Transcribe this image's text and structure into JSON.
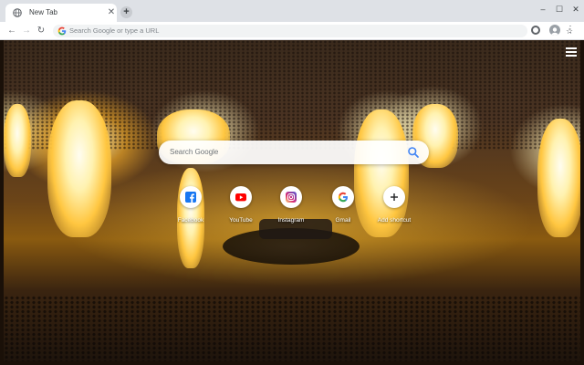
{
  "tab": {
    "title": "New Tab",
    "close_glyph": "✕",
    "favicon": "globe-icon"
  },
  "new_tab_glyph": "+",
  "window_controls": {
    "minimize": "–",
    "maximize": "☐",
    "close": "✕"
  },
  "nav": {
    "back": "←",
    "forward": "→",
    "reload": "↻"
  },
  "omnibox": {
    "placeholder": "Search Google or type a URL",
    "star": "☆"
  },
  "menu_glyph": "⋮",
  "search": {
    "placeholder": "Search Google"
  },
  "shortcuts": [
    {
      "label": "Facebook",
      "icon": "facebook-icon",
      "color": "#1877f2"
    },
    {
      "label": "YouTube",
      "icon": "youtube-icon",
      "color": "#ff0000"
    },
    {
      "label": "Instagram",
      "icon": "instagram-icon",
      "color": "#c13584"
    },
    {
      "label": "Gmail",
      "icon": "google-icon",
      "color": "#4285f4"
    },
    {
      "label": "Add shortcut",
      "icon": "plus-icon",
      "color": "#202124"
    }
  ]
}
